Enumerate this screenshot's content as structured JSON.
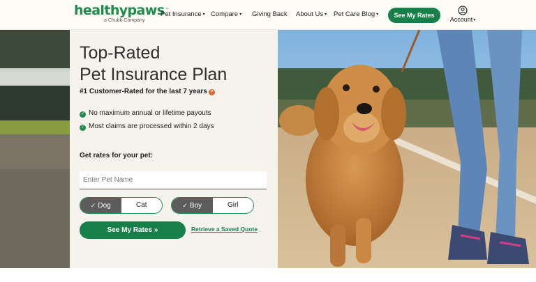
{
  "brand": {
    "name": "healthypaws",
    "trademark": "™",
    "tagline": "a Chubb Company",
    "color": "#1f8a4c"
  },
  "nav": {
    "items": [
      {
        "label": "Pet Insurance",
        "has_dropdown": true
      },
      {
        "label": "Compare",
        "has_dropdown": true
      },
      {
        "label": "Giving Back",
        "has_dropdown": false
      },
      {
        "label": "About Us",
        "has_dropdown": true
      },
      {
        "label": "Pet Care Blog",
        "has_dropdown": true
      }
    ],
    "cta": "See My Rates",
    "account": {
      "label": "Account",
      "icon": "user-circle-icon",
      "has_dropdown": true
    },
    "caret": "▾"
  },
  "hero": {
    "title_line1": "Top-Rated",
    "title_line2": "Pet Insurance Plan",
    "subtitle": "#1 Customer-Rated for the last 7 years",
    "info_icon": "?",
    "bullets": [
      "No maximum annual or lifetime payouts",
      "Most claims are processed within 2 days"
    ],
    "form": {
      "label": "Get rates for your pet:",
      "pet_name_placeholder": "Enter Pet Name",
      "pet_name_value": "",
      "species": {
        "options": [
          "Dog",
          "Cat"
        ],
        "selected": "Dog"
      },
      "gender": {
        "options": [
          "Boy",
          "Girl"
        ],
        "selected": "Boy"
      },
      "submit": "See My Rates »",
      "retrieve": "Retrieve a Saved Quote"
    },
    "photo_alt_icon": "golden-retriever-photo"
  },
  "colors": {
    "accent": "#17804a",
    "panel_bg": "#f6f3ed",
    "selected_toggle": "#5c5c5c",
    "info_orange": "#e2602c"
  }
}
